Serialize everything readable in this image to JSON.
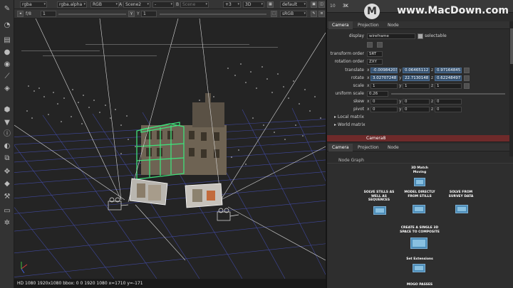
{
  "viewer_toolbar": {
    "row1": {
      "channels": "rgba",
      "layer": "rgba.alpha",
      "colorspace": "RGB",
      "a_label": "A",
      "a_input": "Scene2",
      "a_operation": "-",
      "b_label": "B",
      "b_input": "Scene",
      "zoom": "+3",
      "view_mode": "3D",
      "camera": "default"
    },
    "row2": {
      "fstop_label": "f/8",
      "fstop_value": "1",
      "y_label": "Y",
      "y_value": "1",
      "lut": "sRGB"
    }
  },
  "status_bar": {
    "text": "HD 1080 1920x1080 bbox: 0 0 1920 1080  x=1710 y=-171"
  },
  "right_panel": {
    "top_tab_number": "10",
    "top_title": "3K",
    "watermark": "www.MacDown.com",
    "watermark_logo": "M",
    "tabs": [
      "Camera",
      "Projection",
      "Node"
    ],
    "params": {
      "display_label": "display",
      "display_value": "wireframe",
      "selectable_label": "selectable",
      "transform_order_label": "transform order",
      "transform_order_value": "SRT",
      "rotation_order_label": "rotation order",
      "rotation_order_value": "ZXY",
      "translate_label": "translate",
      "translate": {
        "x": "-0.00984203",
        "y": "0.06465112",
        "z": "0.97164845"
      },
      "rotate_label": "rotate",
      "rotate": {
        "x": "3.02707248",
        "y": "22.7130148",
        "z": "0.62248497"
      },
      "scale_label": "scale",
      "scale": {
        "x": "1",
        "y": "1",
        "z": "1"
      },
      "uniform_scale_label": "uniform scale",
      "uniform_scale": "0.26",
      "skew_label": "skew",
      "skew": {
        "x": "0",
        "y": "0",
        "z": "0"
      },
      "pivot_label": "pivot",
      "pivot": {
        "x": "0",
        "y": "0",
        "z": "0"
      },
      "local_matrix": "Local matrix",
      "world_matrix": "World matrix",
      "axis_x": "x",
      "axis_y": "y",
      "axis_z": "z"
    },
    "second_node_name": "Camera8",
    "second_tabs": [
      "Camera",
      "Projection",
      "Node"
    ],
    "node_graph": {
      "title": "Node Graph",
      "labels": {
        "match_moving": "3D Match Moving",
        "solve_stills": "SOLVE STILLS AS WELL AS SEQUENCES",
        "model_directly": "MODEL DIRECTLY FROM STILLS",
        "solve_survey": "SOLVE FROM SURVEY DATA",
        "create_space": "CREATE A SINGLE 3D SPACE TO COMPOSITE",
        "set_extensions": "Set Extensions",
        "mogo_passes": "MOGO PASSES"
      }
    }
  },
  "colors": {
    "selection_green": "#3fe07a",
    "node_blue": "#4c8cb7",
    "camera_bar": "#6e2a2a",
    "highlight_field": "#34506e"
  },
  "icons": [
    "pencil-icon",
    "clock-icon",
    "stack-icon",
    "circle-icon",
    "drop-icon",
    "brush-icon",
    "layers-icon",
    "cube-icon",
    "filter-icon",
    "info-icon",
    "mask-icon",
    "merge-icon",
    "transform-icon",
    "tag-icon",
    "wrench-icon",
    "toolbox-icon",
    "settings-icon"
  ]
}
